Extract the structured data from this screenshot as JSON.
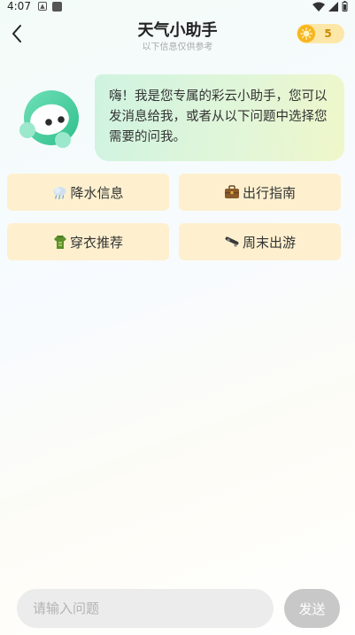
{
  "status_bar": {
    "time": "4:07"
  },
  "header": {
    "title": "天气小助手",
    "subtitle": "以下信息仅供参考",
    "coin_count": "5"
  },
  "chat": {
    "greeting": "嗨！我是您专属的彩云小助手，您可以发消息给我，或者从以下问题中选择您需要的问我。"
  },
  "quick_questions": [
    {
      "label": "降水信息",
      "icon": "rain-cloud-icon"
    },
    {
      "label": "出行指南",
      "icon": "briefcase-icon"
    },
    {
      "label": "穿衣推荐",
      "icon": "clothes-icon"
    },
    {
      "label": "周末出游",
      "icon": "skateboard-icon"
    }
  ],
  "input": {
    "placeholder": "请输入问题",
    "value": ""
  },
  "send_label": "发送",
  "colors": {
    "bubble_start": "#cff3e1",
    "bubble_end": "#eff7c9",
    "quick_button": "#fef0cf",
    "coin_badge": "#fde7a8",
    "coin": "#f7b51e",
    "send_disabled": "#c8c8c8",
    "bot": "#4fd3a4"
  }
}
